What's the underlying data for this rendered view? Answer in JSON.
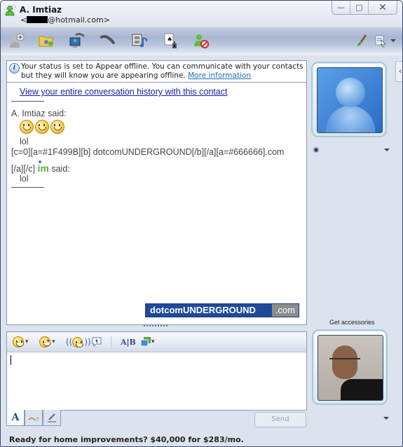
{
  "window": {
    "contact_name": "A. Imtiaz",
    "contact_email_prefix": "<",
    "contact_email_suffix": "@hotmail.com>",
    "controls": {
      "minimize": "—",
      "maximize": "□",
      "close": "✕"
    }
  },
  "toolbar": {
    "buttons": [
      {
        "name": "invite-contact",
        "glyph": "👤"
      },
      {
        "name": "share-files",
        "glyph": "📁"
      },
      {
        "name": "video-call",
        "glyph": "🖥"
      },
      {
        "name": "voice-call",
        "glyph": "☎"
      },
      {
        "name": "share-media",
        "glyph": "🎞"
      },
      {
        "name": "games",
        "glyph": "♠"
      },
      {
        "name": "block-contact",
        "glyph": "⛔"
      }
    ],
    "right_buttons": [
      {
        "name": "theme",
        "glyph": "🖌"
      },
      {
        "name": "show-menu",
        "glyph": "▤"
      }
    ]
  },
  "conversation": {
    "info_message": "Your status is set to Appear offline. You can communicate with your contacts but they will know you are appearing offline.",
    "info_link": "More information",
    "history_link": "View your entire conversation history with this contact",
    "messages": [
      {
        "sender_line": "A. Imtiaz said:",
        "emoticons": 3,
        "text": "lol"
      },
      {
        "sender_line_1": "[c=0][a=#1F499B][b] dotcomUNDERGROUND[/b][/a][a=#666666].com",
        "sender_line_2_prefix": "[/a][/c]",
        "sender_line_2_logo": "im",
        "sender_line_2_suffix": " said:",
        "text": "lol"
      }
    ],
    "banner": {
      "main": "dotcomUNDERGROUND",
      "suffix": ".com",
      "main_color": "#1F499B",
      "suffix_color": "#8c8c8c"
    }
  },
  "input": {
    "toolbar": [
      {
        "name": "emoticons",
        "has_dropdown": true
      },
      {
        "name": "winks",
        "has_dropdown": true
      },
      {
        "name": "nudge",
        "has_dropdown": false
      },
      {
        "name": "voice-clip",
        "has_dropdown": false
      },
      {
        "name": "font",
        "has_dropdown": false
      },
      {
        "name": "backgrounds",
        "has_dropdown": true
      }
    ],
    "value": "",
    "font_tab": "A",
    "send_label": "Send"
  },
  "sidebar": {
    "collapse_glyph": "‹",
    "get_accessories": "Get accessories"
  },
  "status_bar": {
    "ad_text": "Ready for home improvements? $40,000 for $283/mo."
  }
}
